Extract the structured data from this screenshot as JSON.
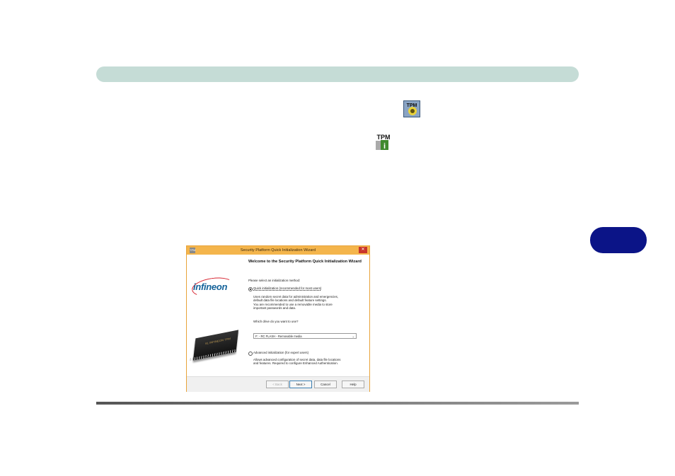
{
  "page": {
    "chapter_tab_color": "#0b1487",
    "header_bar_color": "#c5dcd6"
  },
  "icons": {
    "tpm_icon_1": "TPM",
    "tpm_icon_2": "TPM"
  },
  "wizard": {
    "title": "Security Platform Quick Initialization Wizard",
    "close": "✕",
    "logo": "infineon",
    "chip_label": "SL INFINEON TPM",
    "heading": "Welcome to the Security Platform Quick Initialization Wizard",
    "prompt": "Please select an initialization method:",
    "option_quick": {
      "label": "Quick initialization (recommended for most users)",
      "selected": true,
      "description_lines": [
        "Uses random secret data for administration and emergencies,",
        "default data file locations and default feature settings.",
        "You are recommended to use a removable media to store",
        "important passwords and data."
      ]
    },
    "drive_prompt": "Which drive do you want to use?",
    "drive_value": "F: - RC FLASH - Removable media",
    "option_advanced": {
      "label": "Advanced initialization (for expert users)",
      "selected": false,
      "description_lines": [
        "Allows advanced configuration of secret data, data file locations",
        "and features. Required to configure Enhanced Authentication."
      ]
    },
    "buttons": {
      "back": "< Back",
      "next": "Next >",
      "cancel": "Cancel",
      "help": "Help"
    }
  }
}
